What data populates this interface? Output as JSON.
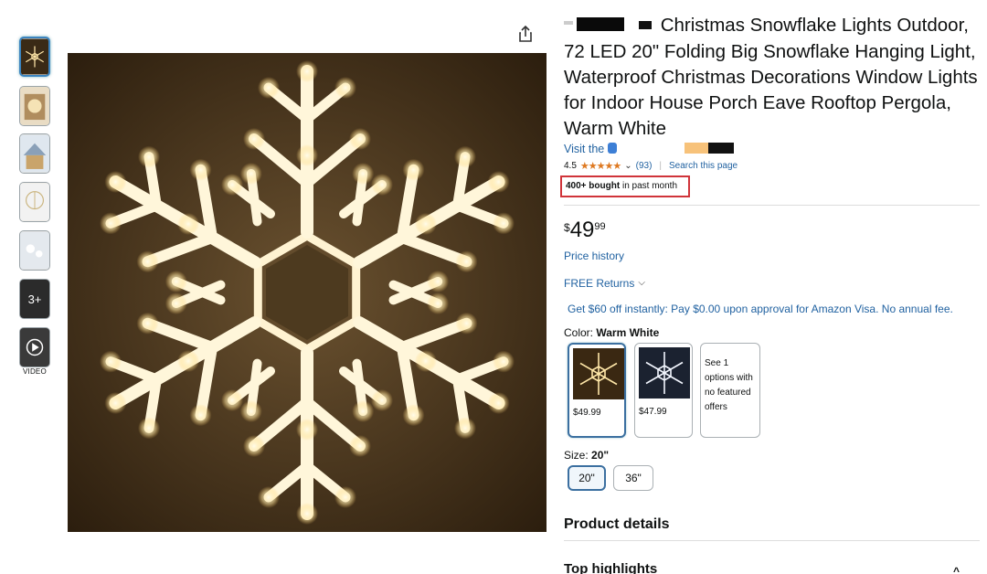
{
  "thumbnails": [
    {
      "label": "",
      "kind": "image"
    },
    {
      "label": "",
      "kind": "image"
    },
    {
      "label": "",
      "kind": "image"
    },
    {
      "label": "",
      "kind": "image"
    },
    {
      "label": "",
      "kind": "image"
    },
    {
      "label": "3+",
      "kind": "more"
    },
    {
      "label": "",
      "kind": "video"
    }
  ],
  "video_label": "VIDEO",
  "share_icon": "share-icon",
  "product": {
    "title": "Christmas Snowflake Lights Outdoor, 72 LED 20\" Folding Big Snowflake Hanging Light, Waterproof Christmas Decorations Window Lights for Indoor House Porch Eave Rooftop Pergola, Warm White",
    "store_link": "Visit the",
    "rating": "4.5",
    "review_count": "(93)",
    "search_page": "Search this page",
    "bought_bold": "400+ bought",
    "bought_rest": "in past month",
    "price_symbol": "$",
    "price_whole": "49",
    "price_fraction": "99",
    "price_history": "Price history",
    "free_returns": "FREE Returns",
    "promo": "Get $60 off instantly: Pay $0.00 upon approval for Amazon Visa. No annual fee.",
    "color_label": "Color:",
    "color_value": "Warm White",
    "swatches": [
      {
        "price": "$49.99",
        "color": "warm white"
      },
      {
        "price": "$47.99",
        "color": "cool white"
      }
    ],
    "see_options": "See 1 options with no featured offers",
    "size_label": "Size:",
    "size_value": "20\"",
    "sizes": [
      "20\"",
      "36\""
    ],
    "product_details": "Product details",
    "top_highlights": "Top highlights"
  },
  "colors": {
    "link": "#2162a1",
    "highlight_box": "#d0343a",
    "star": "#de7921"
  }
}
